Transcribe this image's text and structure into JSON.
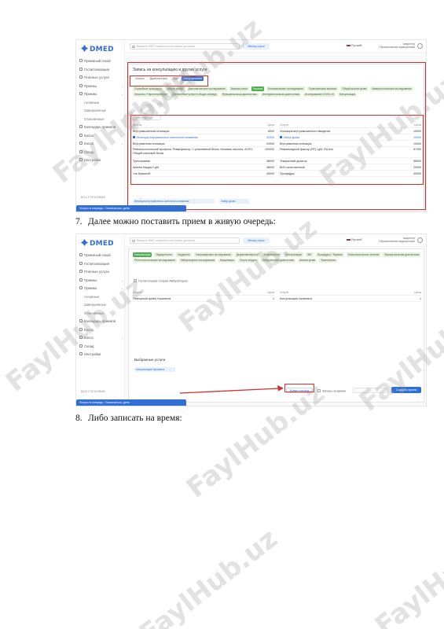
{
  "app": {
    "logo": "DMED",
    "search_placeholder": "Введите ФИО пациента или номер договора",
    "month_button": "Месяц сорок",
    "lang": "Русский",
    "user_line1": "медсёстр",
    "user_line2": "Пёрсвиглавная медицинская"
  },
  "sidebar": {
    "items": [
      "Приемный покой",
      "Госпитализация",
      "Платные услуги",
      "Приемы",
      "Приемы",
      "Активные",
      "Завершённые",
      "Отменённые",
      "Календарь приемов",
      "Кассы",
      "Касса",
      "Склад",
      "Настройки"
    ],
    "footer": "ВОССТЕНОВИЕ",
    "toast": "Услуги в очередь / Записаться: день"
  },
  "shot1": {
    "card_title": "Запись на консультацию и другие услуги",
    "tabs": [
      "Услуги",
      "Диагностика",
      "Лаб",
      "Направления"
    ],
    "active_tab": "Направления",
    "chips": [
      "Служебные процедуры",
      "Анализ крови",
      "Дополнительные исследования",
      "Анализы мочи",
      "Терапия",
      "Биохимические исследования",
      "Гормональные анализы",
      "Общий анализ крови",
      "Иммунологические исследования",
      "Гепатиты / Парентеральные",
      "Оплаченные услуги в общую очередь",
      "Функциональная диагностика",
      "Инструментальная диагностика",
      "Исследования COVID-19",
      "Консультации"
    ],
    "active_chip": "Терапия",
    "service_search": "Найти услугу",
    "col_headers": [
      "Услуга",
      "Цена"
    ],
    "left_rows": [
      {
        "name": "Внутримышечная инъекция",
        "price": "8000"
      },
      {
        "name": "Инъекция внутривенного капельного вливания",
        "price": "32000",
        "selected": true
      },
      {
        "name": "Внутривенная инъекция",
        "price": "20000"
      },
      {
        "name": "Ревматологический профиль: Ревмофактор, С-реактивный белок, Мочевая кислота, АСЛО, Общий сиаловой белок",
        "price": "150000",
        "tall": true
      },
      {
        "name": "Трихограмма",
        "price": "48000"
      },
      {
        "name": "Анализ Кардио LgM",
        "price": "48000"
      },
      {
        "name": "Узи брюшной",
        "price": "45000"
      }
    ],
    "right_rows": [
      {
        "name": "Инъекция внутримышечного введения",
        "price": "15000"
      },
      {
        "name": "Забор крови",
        "price": "10000",
        "selected": true
      },
      {
        "name": "Внутривенная инъекция",
        "price": "10000"
      },
      {
        "name": "Ревматоидный фактор (RF) LgM, RA test",
        "price": "57000",
        "tall": true
      },
      {
        "name": "Эпикризный дозатор",
        "price": "58000"
      },
      {
        "name": "ВИЧ качественный",
        "price": "25000"
      },
      {
        "name": "Процедуры",
        "price": "45000"
      }
    ],
    "selected_title": "Выбранные услуги",
    "selected_chips": [
      "Инъекция внутривенного капельного вливания",
      "Забор крови"
    ]
  },
  "step7": {
    "num": "7.",
    "text": "Далее можно поставить прием в живую очередь:"
  },
  "shot2": {
    "chips": [
      "Консультации",
      "Эндокринолог",
      "Кардиолог",
      "Ультразвуковое исследование",
      "Дерматовенеролог",
      "Неврапатолог",
      "Консультации",
      "ЭКГ",
      "Процедуры / Терапия",
      "Гинекологическое лечение",
      "Функциональная диагностика",
      "Рентгенологические исследования",
      "Лабораторные исследования",
      "Вакцинация",
      "Услуги хирурга",
      "Лабораторная диагностика",
      "Анализ крови",
      "Гематология"
    ],
    "active_chip": "Консультации",
    "ambulance_label": "Госпитальная Скорая Амбулатория",
    "col_headers": [
      "Услуга",
      "Цена",
      "Услуга",
      "Цена"
    ],
    "left_rows": [
      {
        "name": "Повторный приём терапевта",
        "price": "1"
      }
    ],
    "right_rows": [
      {
        "name": "Консультация терапевта",
        "price": "1"
      }
    ],
    "selected_title": "Выбранные услуги",
    "selected_chips": [
      "Консультация терапевта"
    ],
    "queue_button": "Живая очередь",
    "time_label": "Запись на время",
    "create_button": "Создать прием"
  },
  "step8": {
    "num": "8.",
    "text": "Либо записать на время:"
  },
  "watermark": "FaylHub.uz",
  "colors": {
    "accent": "#2f6fd6",
    "highlight": "#d32f2f",
    "chip": "#e4f3d9",
    "chip_active": "#4caf50"
  }
}
